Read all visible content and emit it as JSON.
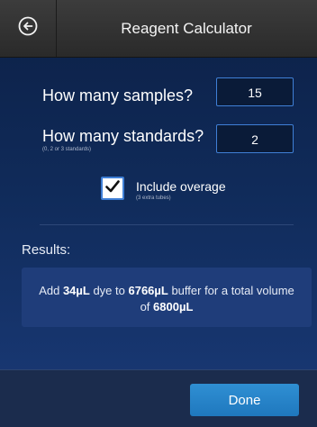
{
  "header": {
    "back_icon": "back-arrow-circle-icon",
    "title": "Reagent Calculator"
  },
  "form": {
    "samples": {
      "label": "How many samples?",
      "value": "15"
    },
    "standards": {
      "label": "How many standards?",
      "hint": "(0, 2 or 3 standards)",
      "value": "2"
    },
    "overage": {
      "checked": true,
      "label": "Include overage",
      "hint": "(3 extra tubes)"
    }
  },
  "results": {
    "label": "Results:",
    "t1": "Add ",
    "dye": "34µL",
    "t2": " dye to ",
    "buffer": "6766µL",
    "t3": " buffer for a total volume of ",
    "total": "6800µL"
  },
  "footer": {
    "done_label": "Done"
  },
  "colors": {
    "accent": "#2f8fd3",
    "input_border": "#3f7fd6",
    "background_top": "#0c2046",
    "background_bottom": "#1a3a78",
    "header": "#333333"
  }
}
